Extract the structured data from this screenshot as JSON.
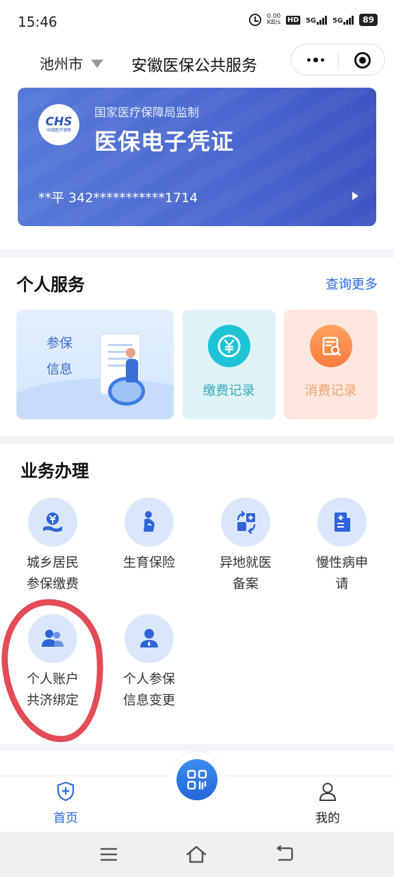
{
  "status_bar": {
    "time": "15:46",
    "net_speed_value": "0.00",
    "net_speed_unit": "KB/s",
    "hd_label": "HD",
    "sim1_label": "5G",
    "sim2_label": "5G",
    "battery": "89"
  },
  "header": {
    "city": "池州市",
    "title": "安徽医保公共服务"
  },
  "card": {
    "logo_text": "CHS",
    "logo_subtext": "中国医疗保障",
    "supervision": "国家医疗保障局监制",
    "title": "医保电子凭证",
    "holder": "**平 342***********1714"
  },
  "personal_services": {
    "title": "个人服务",
    "more": "查询更多",
    "insured_info_line1": "参保",
    "insured_info_line2": "信息",
    "payment_records": "缴费记录",
    "consumption_records": "消费记录"
  },
  "business": {
    "title": "业务办理",
    "items": [
      {
        "line1": "城乡居民",
        "line2": "参保缴费",
        "icon": "yen-hand-icon"
      },
      {
        "line1": "生育保险",
        "line2": "",
        "icon": "pregnant-woman-icon"
      },
      {
        "line1": "异地就医",
        "line2": "备案",
        "icon": "transfer-icon"
      },
      {
        "line1": "慢性病申",
        "line2": "请",
        "icon": "medical-record-icon"
      },
      {
        "line1": "个人账户",
        "line2": "共济绑定",
        "icon": "users-icon"
      },
      {
        "line1": "个人参保",
        "line2": "信息变更",
        "icon": "user-icon"
      }
    ]
  },
  "tabbar": {
    "home": "首页",
    "mine": "我的"
  },
  "colors": {
    "accent": "#2d6bd9",
    "card_start": "#5679d8",
    "card_end": "#3d55c2",
    "annotation": "#e34b56"
  }
}
